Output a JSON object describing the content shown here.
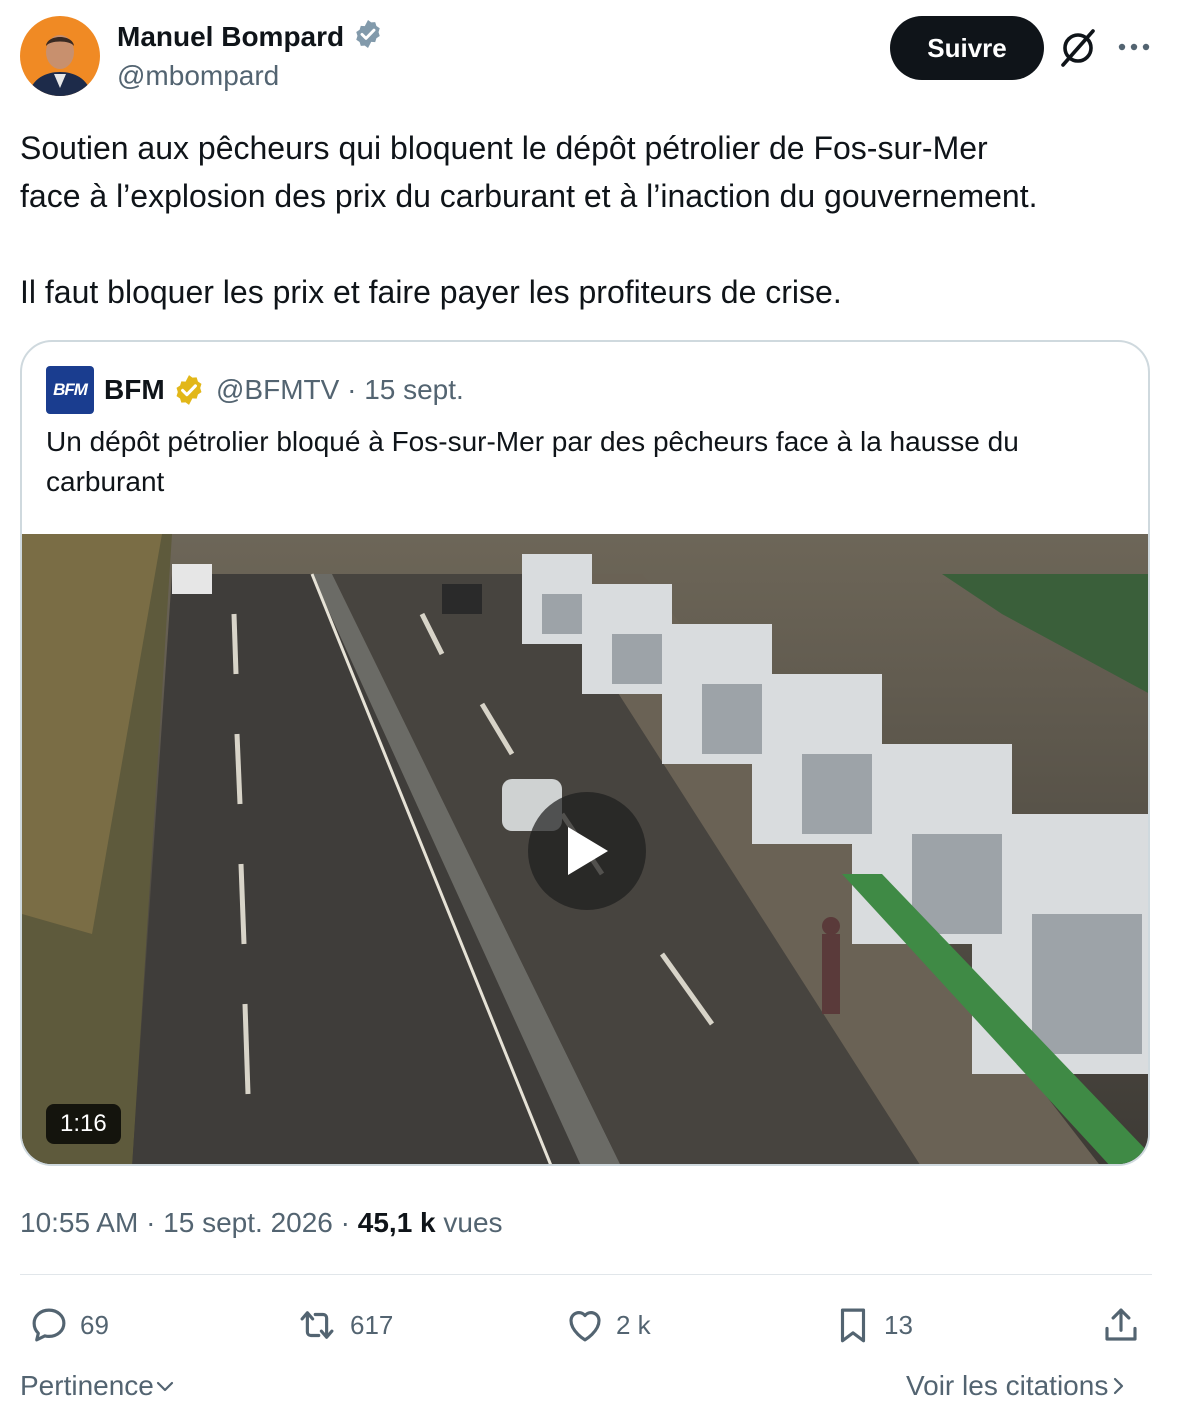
{
  "author": {
    "name": "Manuel Bompard",
    "handle": "@mbompard",
    "follow_label": "Suivre"
  },
  "tweet": {
    "line1": "Soutien aux pêcheurs qui bloquent le dépôt pétrolier de Fos-sur-Mer",
    "line2": "face à l’explosion des prix du carburant et à l’inaction du gouvernement.",
    "line3": "Il faut bloquer les prix et faire payer les profiteurs de crise."
  },
  "quote": {
    "logo_text": "BFM",
    "name": "BFM",
    "meta": "@BFMTV · 15 sept.",
    "text": "Un dépôt pétrolier bloqué à Fos-sur-Mer par des pêcheurs face à la hausse du carburant",
    "duration": "1:16"
  },
  "meta": {
    "time_date": "10:55 AM · 15 sept. 2026 · ",
    "views_count": "45,1 k",
    "views_label": " vues"
  },
  "actions": {
    "replies": "69",
    "reposts": "617",
    "likes": "2 k",
    "bookmarks": "13"
  },
  "footer": {
    "sort_label": "Pertinence",
    "quotes_label": "Voir les citations"
  },
  "colors": {
    "text": "#0f1419",
    "secondary": "#536471",
    "verified_blue": "#829aab",
    "verified_gold": "#e2b719",
    "button_bg": "#0f1419",
    "border": "#cfd9de"
  }
}
